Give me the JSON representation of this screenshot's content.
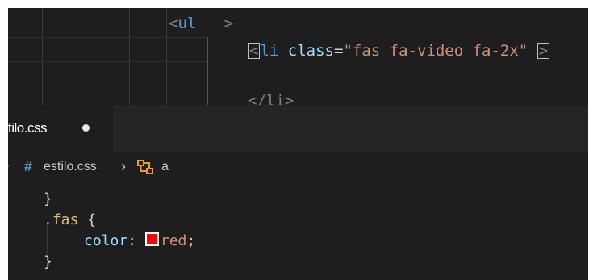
{
  "top_editor": {
    "line1": {
      "open": "<",
      "tag": "ul",
      "close": ">"
    },
    "line2": {
      "open": "<",
      "tag": "li",
      "attr": "class",
      "eq": "=",
      "value": "\"fas fa-video fa-2x\"",
      "close": ">"
    },
    "line3": {
      "text": "</li>"
    }
  },
  "tabs": [
    {
      "label": "stilo.css",
      "modified": true
    }
  ],
  "breadcrumb": {
    "file_icon": "hash-icon",
    "file": "estilo.css",
    "separator": ">",
    "symbol_icon": "symbol-class-icon",
    "symbol": "a"
  },
  "css_code": {
    "line1": "}",
    "selector": ".fas",
    "open_brace": "{",
    "property": "color",
    "colon": ":",
    "value": "red",
    "semicolon": ";",
    "close_brace": "}"
  },
  "colors": {
    "swatch": "#ff0000",
    "tag": "#569cd6",
    "attribute": "#9cdcfe",
    "string": "#ce9178",
    "selector": "#d7ba7d"
  }
}
